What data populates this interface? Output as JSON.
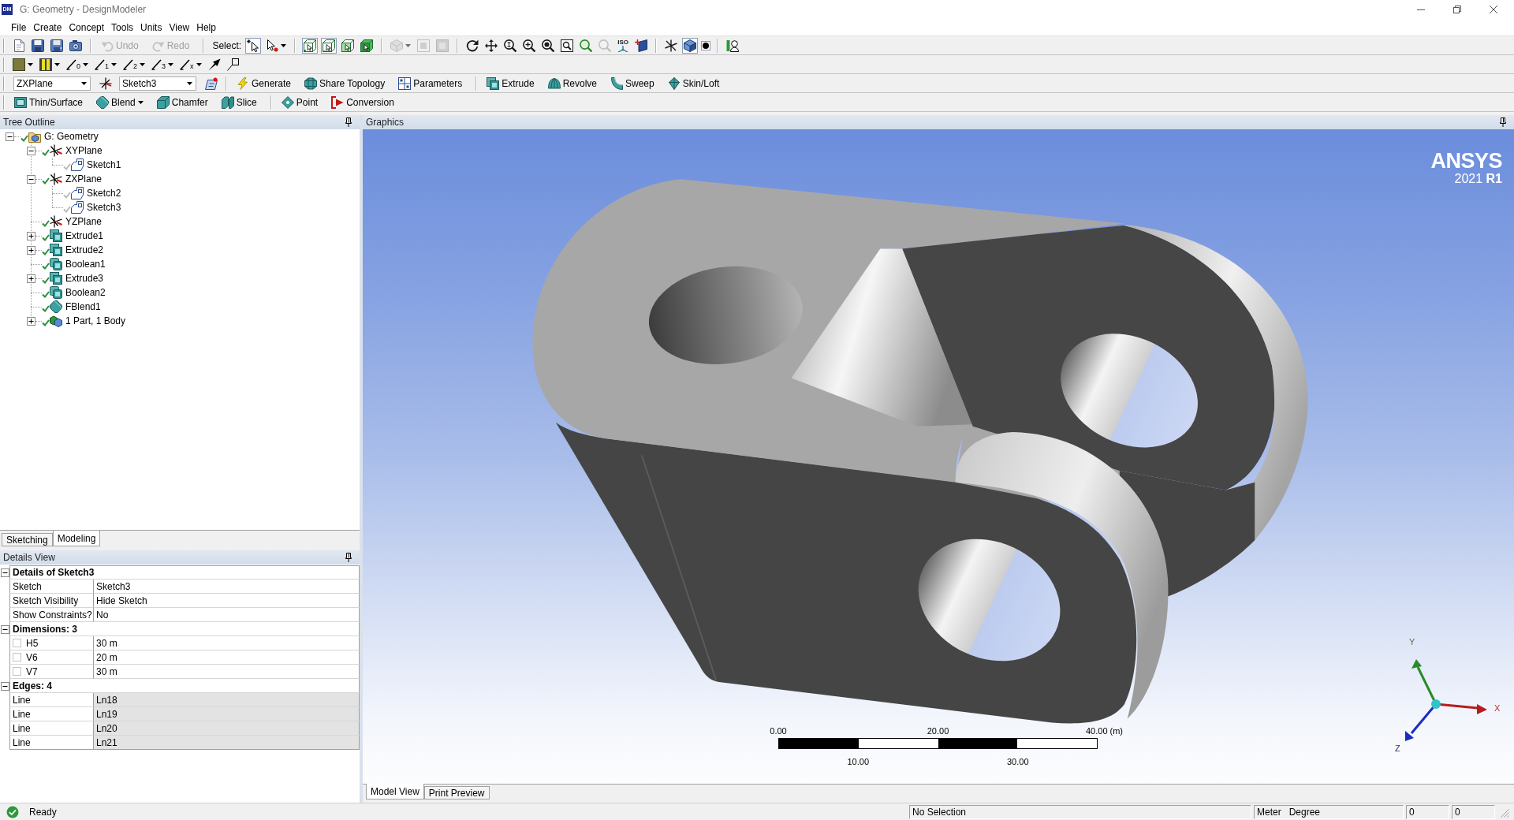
{
  "window": {
    "badge": "DM",
    "title": "G: Geometry - DesignModeler"
  },
  "menu": [
    "File",
    "Create",
    "Concept",
    "Tools",
    "Units",
    "View",
    "Help"
  ],
  "toolbars": [
    {
      "items": [
        {
          "kind": "new",
          "disabled": false,
          "on": false
        },
        {
          "kind": "save",
          "disabled": false,
          "on": false
        },
        {
          "kind": "save_all",
          "disabled": false,
          "on": false
        },
        {
          "kind": "camera",
          "disabled": false,
          "on": false
        },
        {
          "kind": "sep"
        },
        {
          "kind": "undo",
          "label": "Undo",
          "disabled": true,
          "on": false
        },
        {
          "kind": "redo",
          "label": "Redo",
          "disabled": true,
          "on": false
        },
        {
          "kind": "sep"
        },
        {
          "kind": "text",
          "label": "Select:"
        },
        {
          "kind": "select_new",
          "disabled": false,
          "on": true
        },
        {
          "kind": "select_mode",
          "dropdown": true,
          "disabled": false,
          "on": false
        },
        {
          "kind": "sep"
        },
        {
          "kind": "filter_point",
          "disabled": false,
          "on": true
        },
        {
          "kind": "filter_edge",
          "disabled": false,
          "on": true
        },
        {
          "kind": "filter_face",
          "disabled": false,
          "on": false
        },
        {
          "kind": "filter_body",
          "disabled": false,
          "on": false
        },
        {
          "kind": "sep"
        },
        {
          "kind": "extend",
          "dropdown": true,
          "disabled": true,
          "on": false
        },
        {
          "kind": "expand_sel",
          "disabled": true,
          "on": false
        },
        {
          "kind": "shrink_sel",
          "disabled": true,
          "on": false
        },
        {
          "kind": "sep"
        },
        {
          "kind": "rotate",
          "disabled": false,
          "on": false
        },
        {
          "kind": "pan",
          "disabled": false,
          "on": false
        },
        {
          "kind": "zoom",
          "disabled": false,
          "on": false
        },
        {
          "kind": "zoom_in",
          "disabled": false,
          "on": false
        },
        {
          "kind": "zoom_box",
          "disabled": false,
          "on": false
        },
        {
          "kind": "zoom_fit",
          "disabled": false,
          "on": false
        },
        {
          "kind": "view_prev",
          "disabled": false,
          "on": false
        },
        {
          "kind": "view_next",
          "disabled": true,
          "on": false
        },
        {
          "kind": "iso",
          "label": "ISO",
          "disabled": false,
          "on": false
        },
        {
          "kind": "look_at",
          "disabled": false,
          "on": false
        },
        {
          "kind": "sep"
        },
        {
          "kind": "triad",
          "disabled": false,
          "on": false
        },
        {
          "kind": "shaded",
          "disabled": false,
          "on": true
        },
        {
          "kind": "dot",
          "disabled": false,
          "on": true
        },
        {
          "kind": "sep"
        },
        {
          "kind": "head",
          "disabled": false,
          "on": false
        }
      ]
    },
    {
      "items": [
        {
          "kind": "fill_color",
          "dropdown": true
        },
        {
          "kind": "bars",
          "dropdown": true
        },
        {
          "kind": "line",
          "label": "0",
          "dropdown": true
        },
        {
          "kind": "line",
          "label": "1",
          "dropdown": true
        },
        {
          "kind": "line",
          "label": "2",
          "dropdown": true
        },
        {
          "kind": "line",
          "label": "3",
          "dropdown": true
        },
        {
          "kind": "line",
          "label": "x",
          "dropdown": true
        },
        {
          "kind": "pin_arrow"
        },
        {
          "kind": "corner"
        }
      ]
    },
    {
      "items": [
        {
          "kind": "combo",
          "value": "ZXPlane"
        },
        {
          "kind": "new_plane"
        },
        {
          "kind": "combo",
          "value": "Sketch3"
        },
        {
          "kind": "new_sketch"
        },
        {
          "kind": "sep"
        },
        {
          "kind": "generate",
          "label": "Generate"
        },
        {
          "kind": "share_topology",
          "label": "Share Topology"
        },
        {
          "kind": "parameters",
          "label": "Parameters"
        },
        {
          "kind": "sep"
        },
        {
          "kind": "extrude",
          "label": "Extrude"
        },
        {
          "kind": "revolve",
          "label": "Revolve"
        },
        {
          "kind": "sweep",
          "label": "Sweep"
        },
        {
          "kind": "skin_loft",
          "label": "Skin/Loft"
        }
      ]
    },
    {
      "items": [
        {
          "kind": "thin_surface",
          "label": "Thin/Surface"
        },
        {
          "kind": "blend",
          "label": "Blend",
          "dropdown": true
        },
        {
          "kind": "chamfer",
          "label": "Chamfer"
        },
        {
          "kind": "slice",
          "label": "Slice"
        },
        {
          "kind": "sep"
        },
        {
          "kind": "point",
          "label": "Point"
        },
        {
          "kind": "conversion",
          "label": "Conversion"
        }
      ]
    }
  ],
  "tree": {
    "title": "Tree Outline",
    "items": [
      {
        "label": "G: Geometry",
        "kind": "geometry",
        "dimmed": false,
        "expanded": true,
        "children": [
          {
            "label": "XYPlane",
            "kind": "plane",
            "dimmed": false,
            "expanded": true,
            "children": [
              {
                "label": "Sketch1",
                "kind": "sketch",
                "dimmed": true
              }
            ]
          },
          {
            "label": "ZXPlane",
            "kind": "plane",
            "dimmed": false,
            "expanded": true,
            "children": [
              {
                "label": "Sketch2",
                "kind": "sketch",
                "dimmed": true
              },
              {
                "label": "Sketch3",
                "kind": "sketch",
                "dimmed": true
              }
            ]
          },
          {
            "label": "YZPlane",
            "kind": "plane",
            "dimmed": false
          },
          {
            "label": "Extrude1",
            "kind": "extrude",
            "dimmed": false,
            "expanded": false
          },
          {
            "label": "Extrude2",
            "kind": "extrude",
            "dimmed": false,
            "expanded": false
          },
          {
            "label": "Boolean1",
            "kind": "boolean",
            "dimmed": false
          },
          {
            "label": "Extrude3",
            "kind": "extrude",
            "dimmed": false,
            "expanded": false
          },
          {
            "label": "Boolean2",
            "kind": "boolean",
            "dimmed": false
          },
          {
            "label": "FBlend1",
            "kind": "blend",
            "dimmed": false
          },
          {
            "label": "1 Part, 1 Body",
            "kind": "body",
            "dimmed": false,
            "expanded": false
          }
        ]
      }
    ]
  },
  "mode_tabs": [
    {
      "label": "Sketching",
      "selected": false
    },
    {
      "label": "Modeling",
      "selected": true
    }
  ],
  "details": {
    "title": "Details View",
    "groups": [
      {
        "label": "Details of Sketch3",
        "expanded": true,
        "rows": [
          {
            "kind": "plain",
            "label": "Sketch",
            "value": "Sketch3"
          },
          {
            "kind": "plain",
            "label": "Sketch Visibility",
            "value": "Hide Sketch"
          },
          {
            "kind": "plain",
            "label": "Show Constraints?",
            "value": "No"
          }
        ]
      },
      {
        "label": "Dimensions: 3",
        "expanded": true,
        "rows": [
          {
            "kind": "checkbox",
            "checked": false,
            "label": "H5",
            "value": "30 m"
          },
          {
            "kind": "checkbox",
            "checked": false,
            "label": "V6",
            "value": "20 m"
          },
          {
            "kind": "checkbox",
            "checked": false,
            "label": "V7",
            "value": "30 m"
          }
        ]
      },
      {
        "label": "Edges: 4",
        "expanded": true,
        "rows": [
          {
            "kind": "readonly",
            "label": "Line",
            "value": "Ln18"
          },
          {
            "kind": "readonly",
            "label": "Line",
            "value": "Ln19"
          },
          {
            "kind": "readonly",
            "label": "Line",
            "value": "Ln20"
          },
          {
            "kind": "readonly",
            "label": "Line",
            "value": "Ln21"
          }
        ]
      }
    ]
  },
  "graphics": {
    "title": "Graphics",
    "logo": {
      "name": "ANSYS",
      "version": "2021 **R1**"
    },
    "scale_bar": {
      "top_labels": [
        "0.00",
        "20.00",
        "40.00"
      ],
      "unit": "(m)",
      "bottom_labels": [
        "10.00",
        "30.00"
      ]
    },
    "axes": {
      "y": "Y",
      "x": "X",
      "z": "Z"
    },
    "view_tabs": [
      {
        "label": "Model View",
        "selected": true
      },
      {
        "label": "Print Preview",
        "selected": false
      }
    ]
  },
  "status_bar": {
    "message": "Ready",
    "selection": "No Selection",
    "length_unit": "Meter",
    "angle_unit": "Degree",
    "field_1": "0",
    "field_2": "0"
  }
}
